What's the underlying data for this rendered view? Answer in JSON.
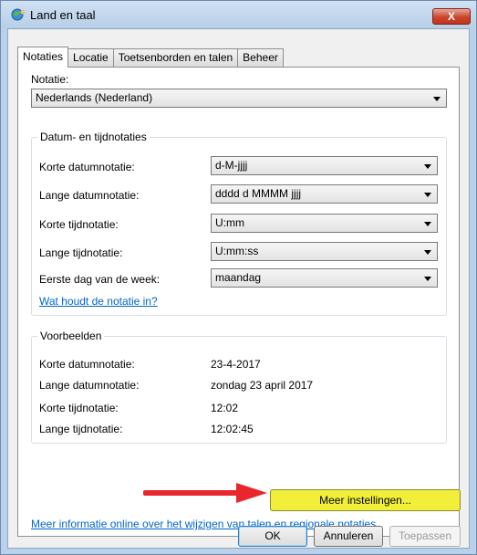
{
  "window": {
    "title": "Land en taal",
    "close_label": "X"
  },
  "tabs": [
    {
      "label": "Notaties"
    },
    {
      "label": "Locatie"
    },
    {
      "label": "Toetsenborden en talen"
    },
    {
      "label": "Beheer"
    }
  ],
  "notatie": {
    "label": "Notatie:",
    "selected": "Nederlands (Nederland)"
  },
  "datum_group": {
    "title": "Datum- en tijdnotaties",
    "rows": [
      {
        "label": "Korte datumnotatie:",
        "value": "d-M-jjjj"
      },
      {
        "label": "Lange datumnotatie:",
        "value": "dddd d MMMM jjjj"
      },
      {
        "label": "Korte tijdnotatie:",
        "value": "U:mm"
      },
      {
        "label": "Lange tijdnotatie:",
        "value": "U:mm:ss"
      },
      {
        "label": "Eerste dag van de week:",
        "value": "maandag"
      }
    ],
    "help_link": "Wat houdt de notatie in?"
  },
  "voorbeelden": {
    "title": "Voorbeelden",
    "rows": [
      {
        "label": "Korte datumnotatie:",
        "value": "23-4-2017"
      },
      {
        "label": "Lange datumnotatie:",
        "value": "zondag 23 april 2017"
      },
      {
        "label": "Korte tijdnotatie:",
        "value": "12:02"
      },
      {
        "label": "Lange tijdnotatie:",
        "value": "12:02:45"
      }
    ]
  },
  "more_settings_label": "Meer instellingen...",
  "info_link": "Meer informatie online over het wijzigen van talen en regionale notaties",
  "buttons": {
    "ok": "OK",
    "cancel": "Annuleren",
    "apply": "Toepassen"
  },
  "colors": {
    "highlight_button": "#f1ef3a",
    "arrow": "#e8262c",
    "link": "#0066cc"
  }
}
